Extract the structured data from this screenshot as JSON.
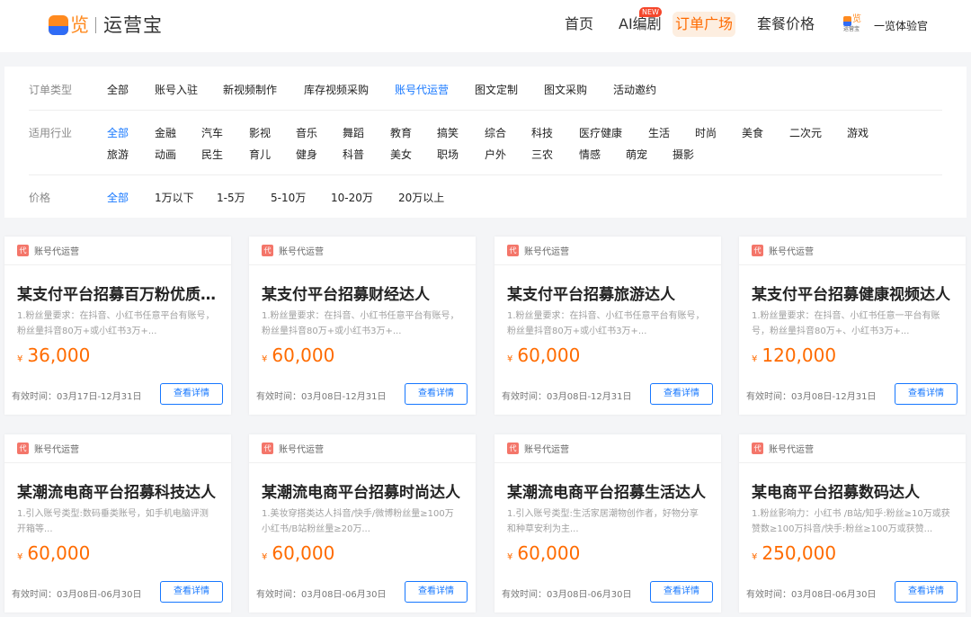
{
  "header": {
    "logo_char": "览",
    "logo_text": "运营宝",
    "nav": [
      "首页",
      "AI编剧",
      "订单广场",
      "套餐价格"
    ],
    "new_badge": "NEW",
    "avatar_char": "览",
    "avatar_text": "运营宝",
    "user_name": "一览体验官"
  },
  "filters": {
    "order_type": {
      "label": "订单类型",
      "options": [
        "全部",
        "账号入驻",
        "新视频制作",
        "库存视频采购",
        "账号代运营",
        "图文定制",
        "图文采购",
        "活动邀约"
      ],
      "active": "账号代运营"
    },
    "industry": {
      "label": "适用行业",
      "options": [
        "全部",
        "金融",
        "汽车",
        "影视",
        "音乐",
        "舞蹈",
        "教育",
        "搞笑",
        "综合",
        "科技",
        "医疗健康",
        "生活",
        "时尚",
        "美食",
        "二次元",
        "游戏",
        "旅游",
        "动画",
        "民生",
        "育儿",
        "健身",
        "科普",
        "美女",
        "职场",
        "户外",
        "三农",
        "情感",
        "萌宠",
        "摄影"
      ],
      "active": "全部"
    },
    "price": {
      "label": "价格",
      "options": [
        "全部",
        "1万以下",
        "1-5万",
        "5-10万",
        "10-20万",
        "20万以上"
      ],
      "active": "全部"
    }
  },
  "card_common": {
    "tag_icon": "代",
    "tag": "账号代运营",
    "currency": "¥",
    "valid_label": "有效时间：",
    "button": "查看详情"
  },
  "cards": [
    {
      "title": "某支付平台招募百万粉优质达人",
      "desc": "1.粉丝量要求：在抖音、小红书任意平台有账号，粉丝量抖音80万+或小红书3万+...",
      "price": "36,000",
      "valid": "03月17日-12月31日"
    },
    {
      "title": "某支付平台招募财经达人",
      "desc": "1.粉丝量要求：在抖音、小红书任意平台有账号，粉丝量抖音80万+或小红书3万+...",
      "price": "60,000",
      "valid": "03月08日-12月31日"
    },
    {
      "title": "某支付平台招募旅游达人",
      "desc": "1.粉丝量要求：在抖音、小红书任意平台有账号，粉丝量抖音80万+或小红书3万+...",
      "price": "60,000",
      "valid": "03月08日-12月31日"
    },
    {
      "title": "某支付平台招募健康视频达人",
      "desc": "1.粉丝量要求：在抖音、小红书任意一平台有账号，粉丝量抖音80万+、小红书3万+...",
      "price": "120,000",
      "valid": "03月08日-12月31日"
    },
    {
      "title": "某潮流电商平台招募科技达人",
      "desc": "1.引入账号类型:数码垂类账号，如手机电脑评测开箱等...",
      "price": "60,000",
      "valid": "03月08日-06月30日"
    },
    {
      "title": "某潮流电商平台招募时尚达人",
      "desc": "1.美妆穿搭类达人抖音/快手/微博粉丝量≥100万小红书/B站粉丝量≥20万...",
      "price": "60,000",
      "valid": "03月08日-06月30日"
    },
    {
      "title": "某潮流电商平台招募生活达人",
      "desc": "1.引入账号类型:生活家居潮物创作者，好物分享和种草安利为主...",
      "price": "60,000",
      "valid": "03月08日-06月30日"
    },
    {
      "title": "某电商平台招募数码达人",
      "desc": "1.粉丝影响力：小红书 /B站/知乎:粉丝≥10万或获赞数≥100万抖音/快手:粉丝≥100万或获赞...",
      "price": "250,000",
      "valid": "03月08日-06月30日"
    }
  ]
}
